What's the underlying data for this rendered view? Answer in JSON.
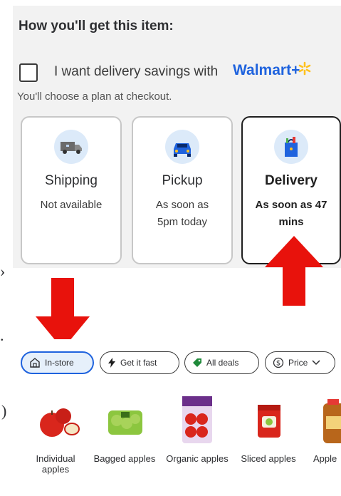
{
  "fulfillment": {
    "title": "How you'll get this item:",
    "savings_label": "I want delivery savings with",
    "walmart_plus_brand": "Walmart+",
    "plan_note": "You'll choose a plan at checkout.",
    "options": [
      {
        "title": "Shipping",
        "subtitle": "Not available",
        "icon": "truck-icon",
        "selected": false
      },
      {
        "title": "Pickup",
        "subtitle": "As soon as 5pm today",
        "icon": "car-icon",
        "selected": false
      },
      {
        "title": "Delivery",
        "subtitle": "As soon as 47 mins",
        "icon": "bag-icon",
        "selected": true
      }
    ]
  },
  "filters": [
    {
      "label": "In-store",
      "icon": "store-icon",
      "active": true
    },
    {
      "label": "Get it fast",
      "icon": "lightning-icon",
      "active": false
    },
    {
      "label": "All deals",
      "icon": "tag-icon",
      "active": false
    },
    {
      "label": "Price",
      "icon": "dollar-icon",
      "active": false
    }
  ],
  "categories": [
    {
      "label": "Individual apples"
    },
    {
      "label": "Bagged apples"
    },
    {
      "label": "Organic apples"
    },
    {
      "label": "Sliced apples"
    },
    {
      "label": "Apple"
    }
  ],
  "colors": {
    "brand_blue": "#1f63de",
    "spark_yellow": "#ffc220",
    "arrow_red": "#e8120c",
    "panel_gray": "#f2f2f2"
  }
}
